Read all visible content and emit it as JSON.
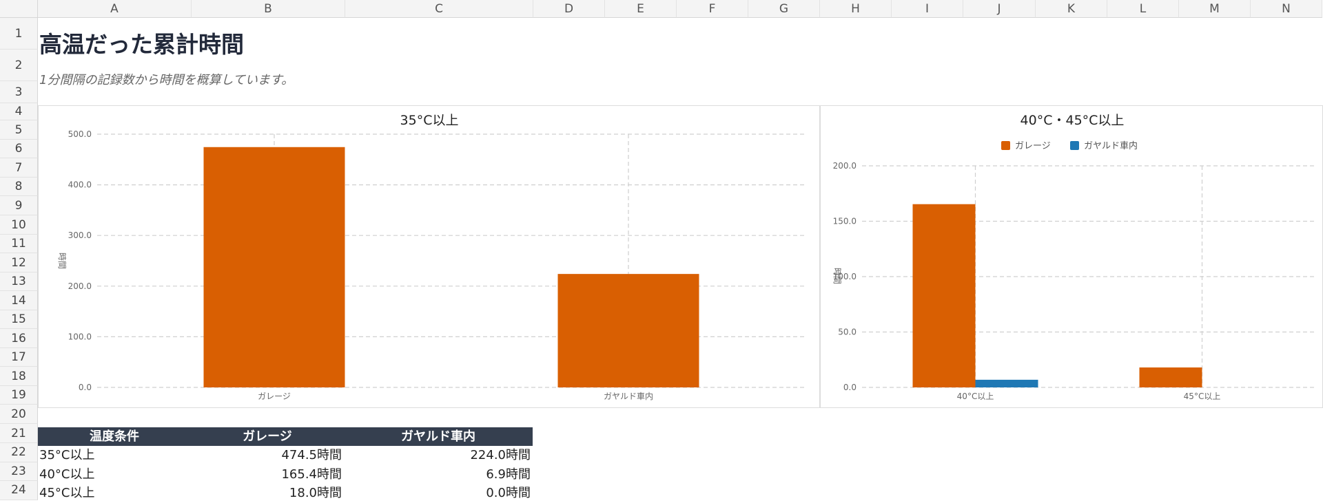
{
  "sheet": {
    "columns": [
      "A",
      "B",
      "C",
      "D",
      "E",
      "F",
      "G",
      "H",
      "I",
      "J",
      "K",
      "L",
      "M",
      "N"
    ],
    "rows": [
      "1",
      "2",
      "3",
      "4",
      "5",
      "6",
      "7",
      "8",
      "9",
      "10",
      "11",
      "12",
      "13",
      "14",
      "15",
      "16",
      "17",
      "18",
      "19",
      "20",
      "21",
      "22",
      "23",
      "24"
    ]
  },
  "title": "高温だった累計時間",
  "subtitle": "1分間隔の記録数から時間を概算しています。",
  "chart_data": [
    {
      "type": "bar",
      "title": "35°C以上",
      "categories": [
        "ガレージ",
        "ガヤルド車内"
      ],
      "values": [
        474.5,
        224.0
      ],
      "ylabel": "時間",
      "xlabel": "",
      "ylim": [
        0,
        500
      ],
      "yticks": [
        "0.0",
        "100.0",
        "200.0",
        "300.0",
        "400.0",
        "500.0"
      ],
      "grid": true,
      "legend": "none",
      "color": "#d95f02"
    },
    {
      "type": "bar",
      "title": "40°C・45°C以上",
      "categories": [
        "40°C以上",
        "45°C以上"
      ],
      "series": [
        {
          "name": "ガレージ",
          "values": [
            165.4,
            18.0
          ],
          "color": "#d95f02"
        },
        {
          "name": "ガヤルド車内",
          "values": [
            6.9,
            0.0
          ],
          "color": "#1f78b4"
        }
      ],
      "ylabel": "時間",
      "xlabel": "",
      "ylim": [
        0,
        200
      ],
      "yticks": [
        "0.0",
        "50.0",
        "100.0",
        "150.0",
        "200.0"
      ],
      "grid": true,
      "legend": "top"
    }
  ],
  "table": {
    "headers": [
      "温度条件",
      "ガレージ",
      "ガヤルド車内"
    ],
    "rows": [
      [
        "35°C以上",
        "474.5時間",
        "224.0時間"
      ],
      [
        "40°C以上",
        "165.4時間",
        "6.9時間"
      ],
      [
        "45°C以上",
        "18.0時間",
        "0.0時間"
      ]
    ]
  }
}
